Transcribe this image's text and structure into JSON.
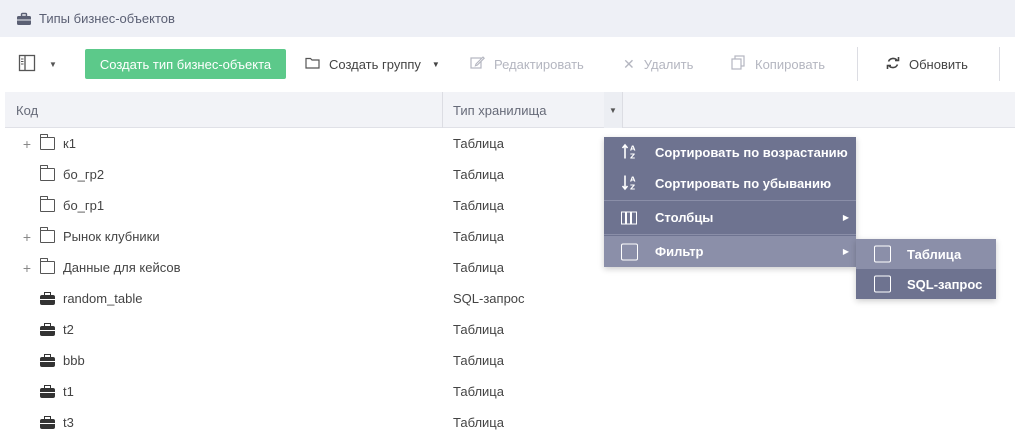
{
  "window": {
    "title": "Типы бизнес-объектов",
    "title_icon": "briefcase-icon"
  },
  "toolbar": {
    "panel_icon": "panel-toggle-icon",
    "create_label": "Создать тип бизнес-объекта",
    "create_group_label": "Создать группу",
    "edit_label": "Редактировать",
    "delete_label": "Удалить",
    "copy_label": "Копировать",
    "refresh_label": "Обновить",
    "accent_color": "#5cc98a"
  },
  "grid": {
    "columns": [
      "Код",
      "Тип хранилища"
    ],
    "rows": [
      {
        "name": "к1",
        "type": "Таблица",
        "icon": "folder-icon",
        "expandable": true
      },
      {
        "name": "бо_гр2",
        "type": "Таблица",
        "icon": "folder-icon",
        "expandable": false
      },
      {
        "name": "бо_гр1",
        "type": "Таблица",
        "icon": "folder-icon",
        "expandable": false
      },
      {
        "name": "Рынок клубники",
        "type": "Таблица",
        "icon": "folder-icon",
        "expandable": true
      },
      {
        "name": "Данные для кейсов",
        "type": "Таблица",
        "icon": "folder-icon",
        "expandable": true
      },
      {
        "name": "random_table",
        "type": "SQL-запрос",
        "icon": "briefcase-icon",
        "expandable": false
      },
      {
        "name": "t2",
        "type": "Таблица",
        "icon": "briefcase-icon",
        "expandable": false
      },
      {
        "name": "bbb",
        "type": "Таблица",
        "icon": "briefcase-icon",
        "expandable": false
      },
      {
        "name": "t1",
        "type": "Таблица",
        "icon": "briefcase-icon",
        "expandable": false
      },
      {
        "name": "t3",
        "type": "Таблица",
        "icon": "briefcase-icon",
        "expandable": false
      }
    ]
  },
  "context_menu": {
    "sort_asc": "Сортировать по возрастанию",
    "sort_desc": "Сортировать по убыванию",
    "columns": "Столбцы",
    "filter": "Фильтр",
    "menu_color": "#6e7390"
  },
  "filter_submenu": {
    "options": [
      "Таблица",
      "SQL-запрос"
    ]
  }
}
